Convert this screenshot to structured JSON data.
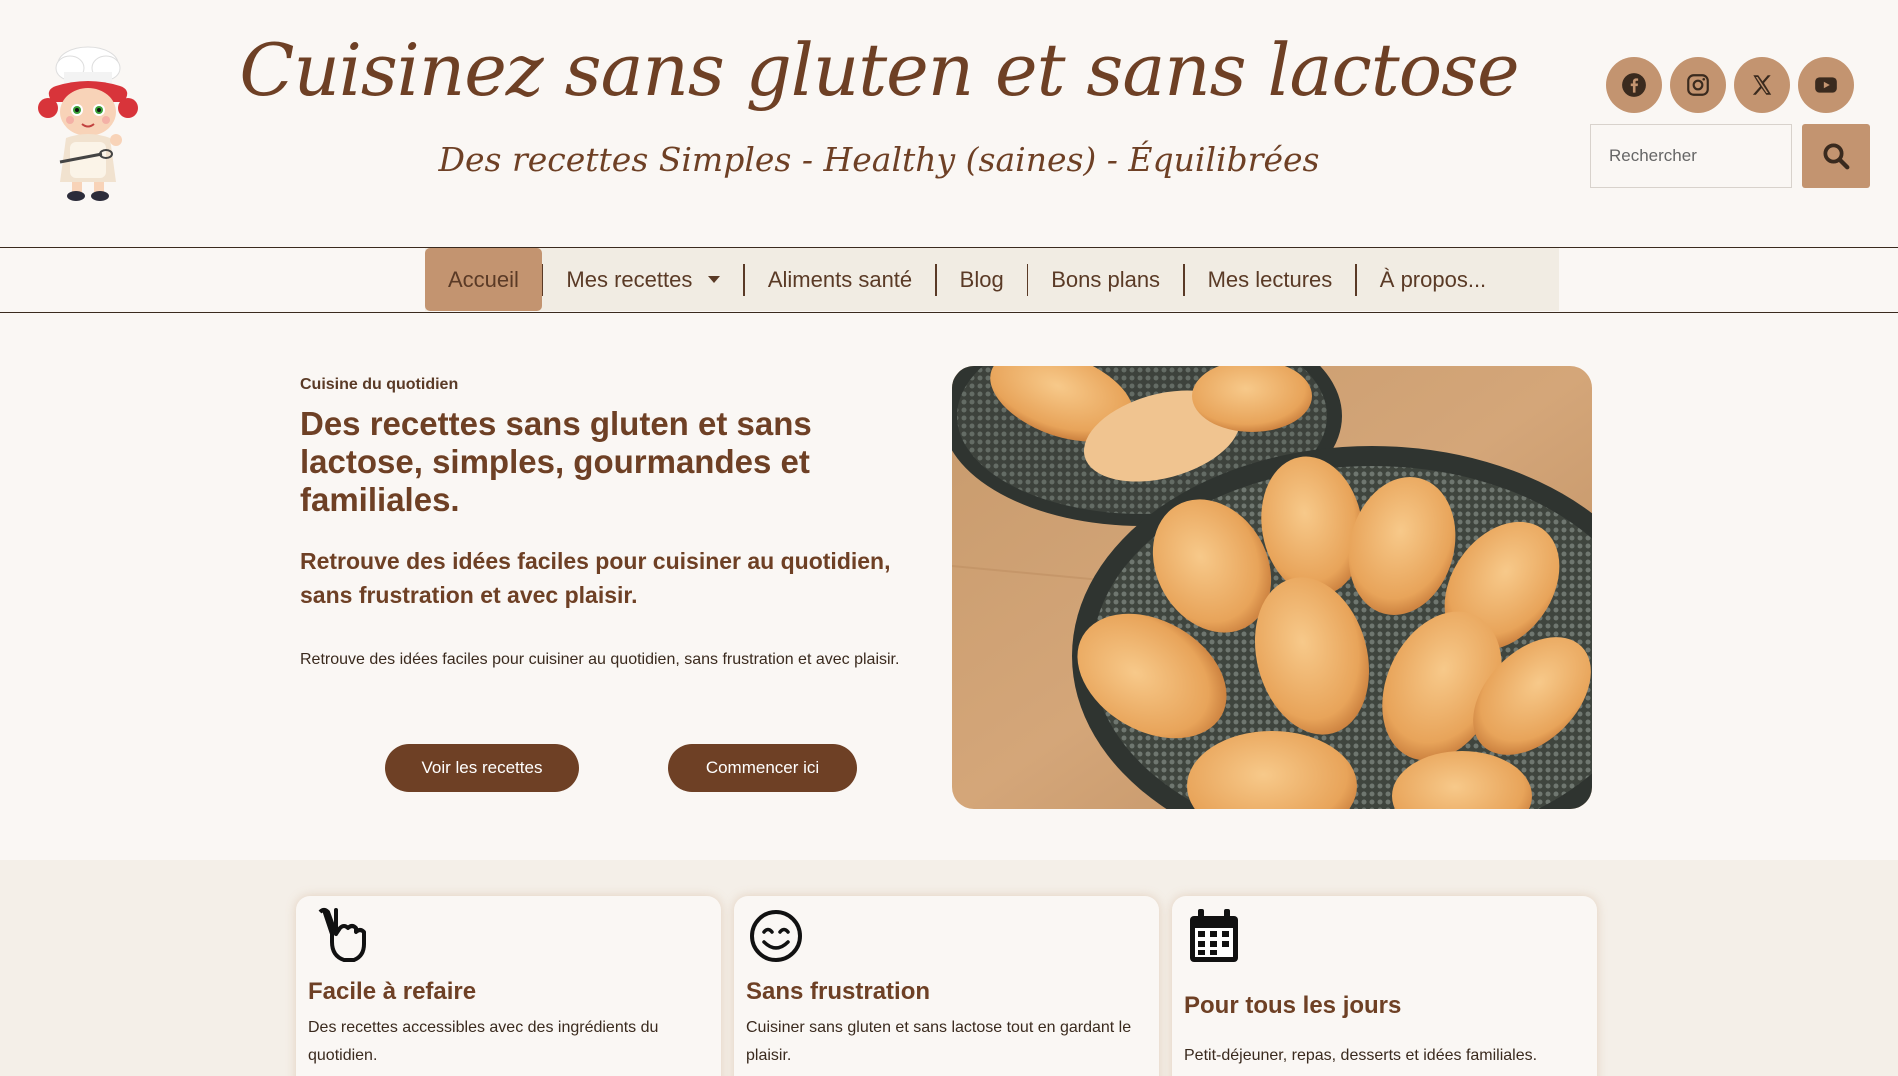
{
  "header": {
    "title": "Cuisinez sans gluten et sans lactose",
    "tagline": "Des recettes Simples - Healthy (saines) - Équilibrées",
    "logo_icon": "chef-girl-mascot-icon",
    "socials": [
      {
        "name": "facebook-icon"
      },
      {
        "name": "instagram-icon"
      },
      {
        "name": "x-icon"
      },
      {
        "name": "youtube-icon"
      }
    ],
    "search": {
      "placeholder": "Rechercher",
      "value": "",
      "button_icon": "search-icon"
    }
  },
  "nav": {
    "items": [
      {
        "label": "Accueil",
        "active": true
      },
      {
        "label": "Mes recettes",
        "has_dropdown": true
      },
      {
        "label": "Aliments santé"
      },
      {
        "label": "Blog"
      },
      {
        "label": "Bons plans"
      },
      {
        "label": "Mes lectures"
      },
      {
        "label": "À propos..."
      }
    ]
  },
  "hero": {
    "kicker": "Cuisine du quotidien",
    "title": "Des recettes sans gluten et sans lactose, simples, gourmandes et familiales.",
    "subtitle": "Retrouve des idées faciles pour cuisiner au quotidien, sans frustration et avec plaisir.",
    "text": "Retrouve des idées faciles pour cuisiner au quotidien, sans frustration et avec plaisir.",
    "btn_recipes": "Voir les recettes",
    "btn_start": "Commencer ici",
    "photo_icon": "madeleines-photo"
  },
  "features": [
    {
      "icon": "peace-hand-icon",
      "title": "Facile à refaire",
      "text": "Des recettes accessibles avec des ingrédients du quotidien."
    },
    {
      "icon": "smile-icon",
      "title": "Sans frustration",
      "text": "Cuisiner sans gluten et sans lactose tout en gardant le plaisir."
    },
    {
      "icon": "calendar-icon",
      "title": "Pour tous les jours",
      "text": "Petit-déjeuner, repas, desserts et idées familiales."
    }
  ],
  "colors": {
    "accent": "#c39470",
    "brown": "#6e4025",
    "background": "#faf7f4",
    "nav_bg": "#f1ece3"
  }
}
